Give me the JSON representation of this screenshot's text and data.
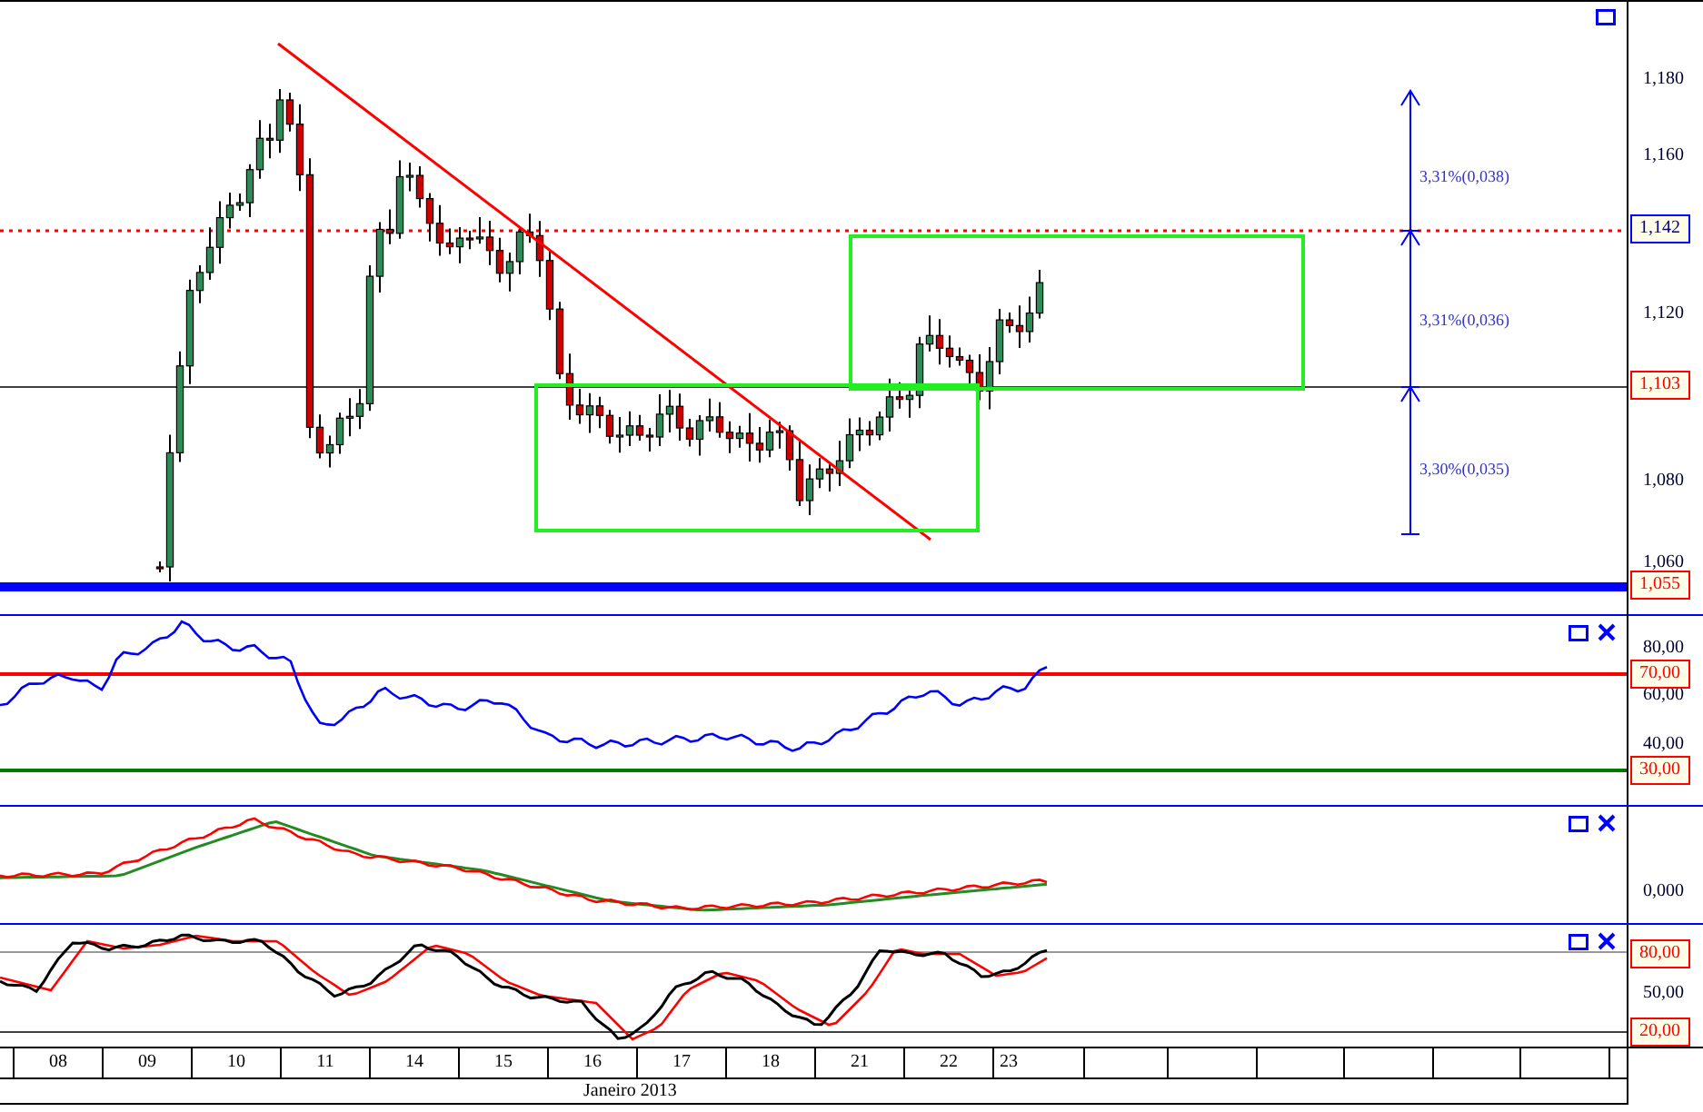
{
  "price_panel": {
    "axis_ticks": [
      "1,180",
      "1,160",
      "1,120",
      "1,080",
      "1,060"
    ],
    "price_tags": [
      {
        "text": "1,142",
        "color": "#0000ff"
      },
      {
        "text": "1,103",
        "color": "#ff0000"
      },
      {
        "text": "1,055",
        "color": "#ff0000"
      }
    ],
    "measurements": [
      "3,31%(0,038)",
      "3,31%(0,036)",
      "3,30%(0,035)"
    ]
  },
  "rsi_panel": {
    "axis_ticks": [
      "80,00",
      "60,00",
      "40,00"
    ],
    "level_tags": [
      "70,00",
      "30,00"
    ]
  },
  "macd_panel": {
    "axis_ticks": [
      "0,000"
    ]
  },
  "stochastic_panel": {
    "axis_ticks": [
      "50,00"
    ],
    "level_tags": [
      "80,00",
      "20,00"
    ]
  },
  "date_axis": {
    "days": [
      "08",
      "09",
      "10",
      "11",
      "14",
      "15",
      "16",
      "17",
      "18",
      "21",
      "22",
      "23"
    ],
    "month": "Janeiro 2013"
  }
}
